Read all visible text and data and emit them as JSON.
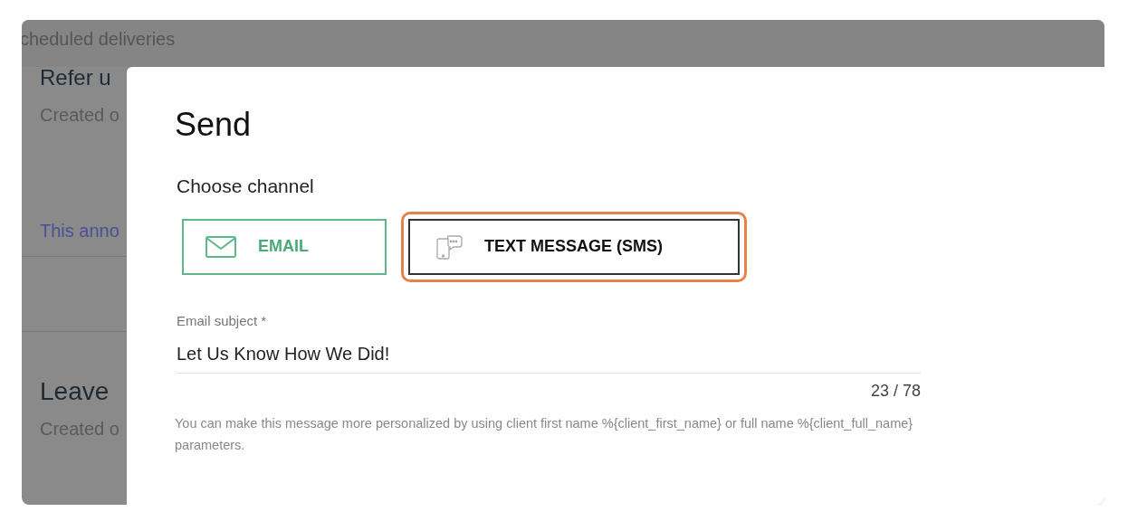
{
  "background": {
    "header": "cheduled deliveries",
    "cards": [
      {
        "title": "Refer u",
        "meta": "Created o",
        "link": "This anno"
      },
      {
        "title": "Leave",
        "meta": "Created o"
      }
    ]
  },
  "dialog": {
    "title": "Send",
    "channel_label": "Choose channel",
    "channels": [
      {
        "kind": "email",
        "label": "EMAIL",
        "selected": true,
        "highlighted": false
      },
      {
        "kind": "sms",
        "label": "TEXT MESSAGE (SMS)",
        "selected": false,
        "highlighted": true
      }
    ],
    "subject": {
      "label": "Email subject *",
      "value": "Let Us Know How We Did!",
      "counter": "23 / 78"
    },
    "help": "You can make this message more personalized by using client first name %{client_first_name} or full name %{client_full_name} parameters."
  }
}
